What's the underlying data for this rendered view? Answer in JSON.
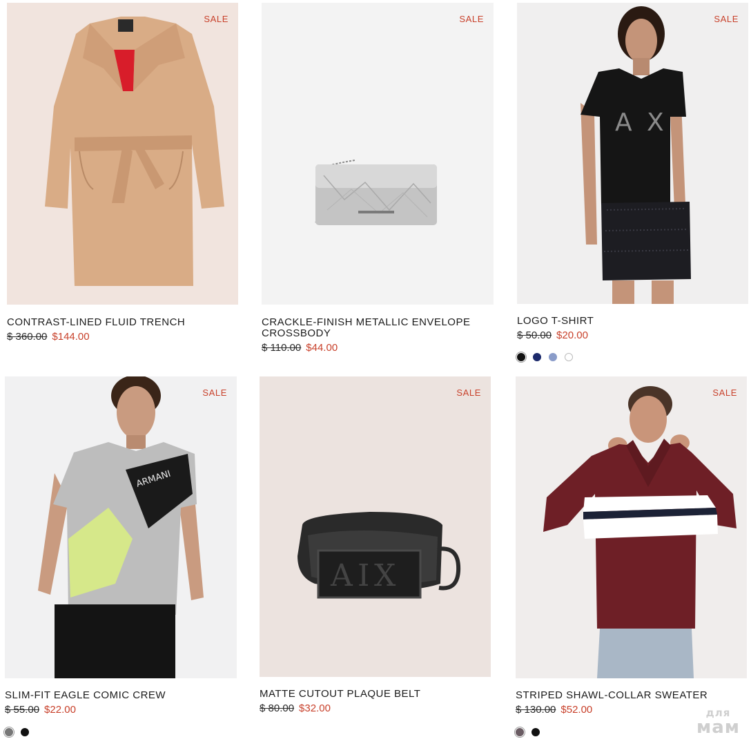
{
  "badge": "SALE",
  "colors": {
    "sale_red": "#c8402a",
    "text": "#1a1a1a"
  },
  "products": [
    {
      "name": "CONTRAST-LINED FLUID TRENCH",
      "old_price": "$ 360.00",
      "price": "$144.00",
      "swatches": []
    },
    {
      "name": "CRACKLE-FINISH METALLIC ENVELOPE CROSSBODY",
      "old_price": "$ 110.00",
      "price": "$44.00",
      "swatches": []
    },
    {
      "name": "LOGO T-SHIRT",
      "old_price": "$ 50.00",
      "price": "$20.00",
      "swatches": [
        "#111111",
        "#1c2a6b",
        "#8a9cc9",
        "#ffffff"
      ]
    },
    {
      "name": "SLIM-FIT EAGLE COMIC CREW",
      "old_price": "$ 55.00",
      "price": "$22.00",
      "swatches": [
        "#777777",
        "#111111"
      ]
    },
    {
      "name": "MATTE CUTOUT PLAQUE BELT",
      "old_price": "$ 80.00",
      "price": "$32.00",
      "swatches": []
    },
    {
      "name": "STRIPED SHAWL-COLLAR SWEATER",
      "old_price": "$ 130.00",
      "price": "$52.00",
      "swatches": [
        "#6a5c63",
        "#111111"
      ]
    }
  ],
  "watermark": {
    "line1": "для",
    "line2": "мам"
  }
}
